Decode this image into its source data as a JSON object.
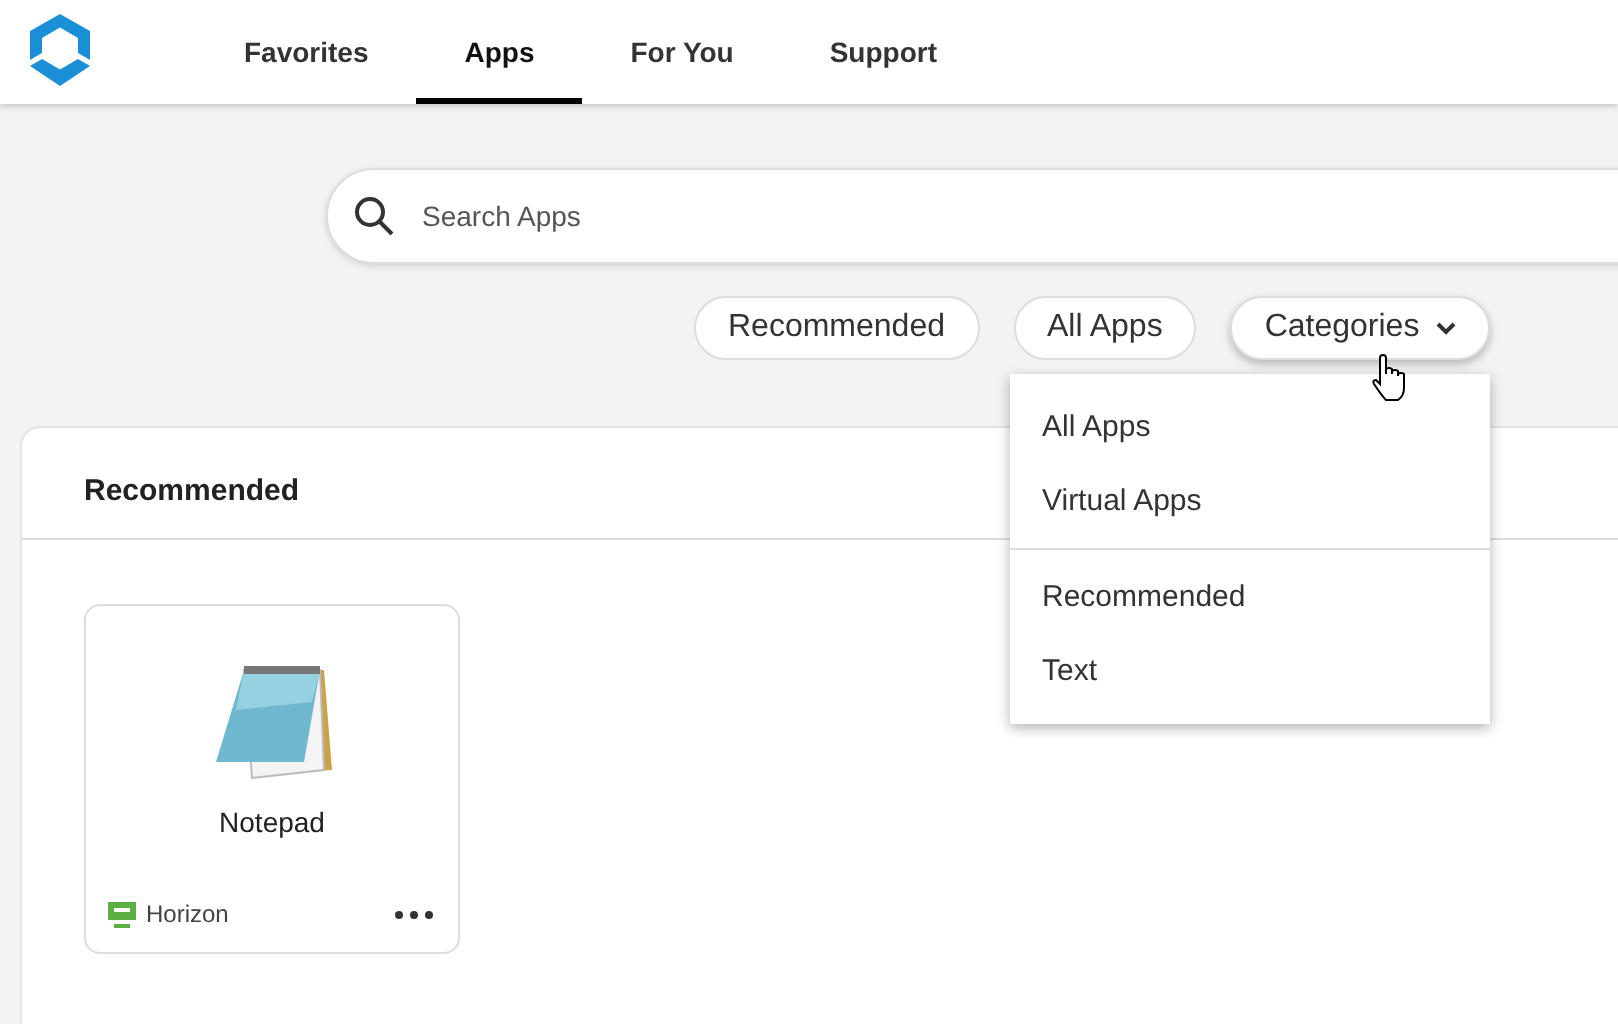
{
  "nav": {
    "tabs": [
      {
        "label": "Favorites",
        "selected": false
      },
      {
        "label": "Apps",
        "selected": true
      },
      {
        "label": "For You",
        "selected": false
      },
      {
        "label": "Support",
        "selected": false
      }
    ]
  },
  "search": {
    "placeholder": "Search Apps"
  },
  "filters": [
    {
      "label": "Recommended",
      "kind": "pill"
    },
    {
      "label": "All Apps",
      "kind": "pill"
    },
    {
      "label": "Categories",
      "kind": "dropdown",
      "expanded": true
    }
  ],
  "categories_menu": {
    "groups": [
      [
        "All Apps",
        "Virtual Apps"
      ],
      [
        "Recommended",
        "Text"
      ]
    ]
  },
  "section": {
    "title": "Recommended",
    "apps": [
      {
        "name": "Notepad",
        "source": "Horizon"
      }
    ]
  }
}
